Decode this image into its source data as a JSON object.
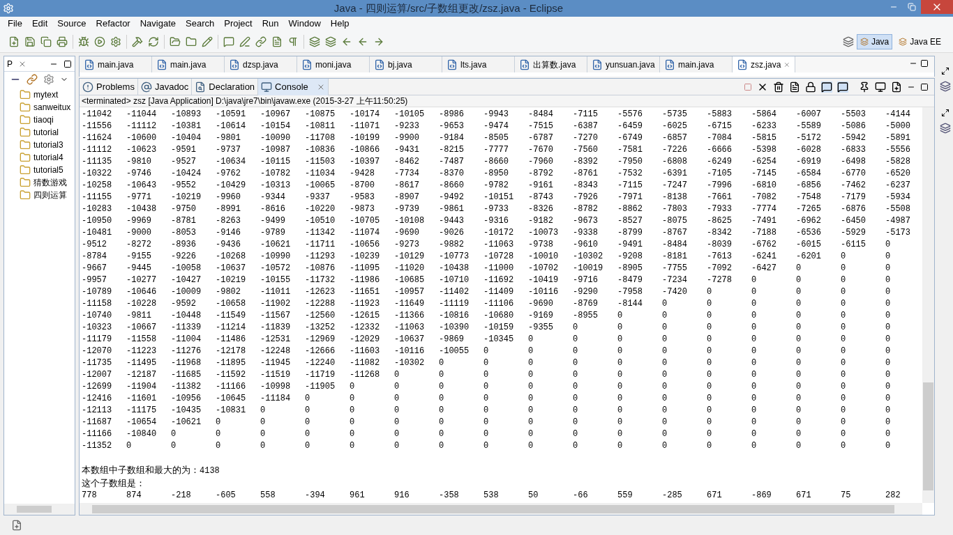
{
  "window": {
    "title": "Java - 四则运算/src/子数组更改/zsz.java - Eclipse"
  },
  "menu": [
    "File",
    "Edit",
    "Source",
    "Refactor",
    "Navigate",
    "Search",
    "Project",
    "Run",
    "Window",
    "Help"
  ],
  "perspectives": [
    {
      "label": "Java",
      "selected": true
    },
    {
      "label": "Java EE",
      "selected": false
    }
  ],
  "package_explorer": {
    "tab": "P",
    "projects": [
      "mytext",
      "sanweitux",
      "tiaoqi",
      "tutorial",
      "tutorial3",
      "tutorial4",
      "tutorial5",
      "猜数游戏",
      "四则运算"
    ]
  },
  "editor_tabs": [
    {
      "label": "main.java",
      "selected": false
    },
    {
      "label": "main.java",
      "selected": false
    },
    {
      "label": "dzsp.java",
      "selected": false
    },
    {
      "label": "moni.java",
      "selected": false
    },
    {
      "label": "bj.java",
      "selected": false
    },
    {
      "label": "lts.java",
      "selected": false
    },
    {
      "label": "出算数.java",
      "selected": false
    },
    {
      "label": "yunsuan.java",
      "selected": false
    },
    {
      "label": "main.java",
      "selected": false
    },
    {
      "label": "zsz.java",
      "selected": true
    }
  ],
  "view_tabs": [
    {
      "label": "Problems",
      "selected": false
    },
    {
      "label": "Javadoc",
      "selected": false
    },
    {
      "label": "Declaration",
      "selected": false
    },
    {
      "label": "Console",
      "selected": true
    }
  ],
  "console": {
    "header": "<terminated> zsz [Java Application] D:\\java\\jre7\\bin\\javaw.exe (2015-3-27 上午11:50:25)",
    "rows": [
      [
        "-11042",
        "-11044",
        "-10893",
        "-10591",
        "-10967",
        "-10875",
        "-10174",
        "-10105",
        "-8986",
        "-9943",
        "-8484",
        "-7115",
        "-5576",
        "-5735",
        "-5883",
        "-5864",
        "-6007",
        "-5503",
        "-4144"
      ],
      [
        "-11556",
        "-11112",
        "-10381",
        "-10614",
        "-10154",
        "-10811",
        "-11071",
        "-9233",
        "-9653",
        "-9474",
        "-7515",
        "-6387",
        "-6459",
        "-6025",
        "-6715",
        "-6233",
        "-5589",
        "-5086",
        "-5000"
      ],
      [
        "-11624",
        "-10600",
        "-10404",
        "-9801",
        "-10090",
        "-11708",
        "-10199",
        "-9900",
        "-9184",
        "-8505",
        "-6787",
        "-7270",
        "-6749",
        "-6857",
        "-7084",
        "-5815",
        "-5172",
        "-5942",
        "-5891"
      ],
      [
        "-11112",
        "-10623",
        "-9591",
        "-9737",
        "-10987",
        "-10836",
        "-10866",
        "-9431",
        "-8215",
        "-7777",
        "-7670",
        "-7560",
        "-7581",
        "-7226",
        "-6666",
        "-5398",
        "-6028",
        "-6833",
        "-5556"
      ],
      [
        "-11135",
        "-9810",
        "-9527",
        "-10634",
        "-10115",
        "-11503",
        "-10397",
        "-8462",
        "-7487",
        "-8660",
        "-7960",
        "-8392",
        "-7950",
        "-6808",
        "-6249",
        "-6254",
        "-6919",
        "-6498",
        "-5828"
      ],
      [
        "-10322",
        "-9746",
        "-10424",
        "-9762",
        "-10782",
        "-11034",
        "-9428",
        "-7734",
        "-8370",
        "-8950",
        "-8792",
        "-8761",
        "-7532",
        "-6391",
        "-7105",
        "-7145",
        "-6584",
        "-6770",
        "-6520"
      ],
      [
        "-10258",
        "-10643",
        "-9552",
        "-10429",
        "-10313",
        "-10065",
        "-8700",
        "-8617",
        "-8660",
        "-9782",
        "-9161",
        "-8343",
        "-7115",
        "-7247",
        "-7996",
        "-6810",
        "-6856",
        "-7462",
        "-6237"
      ],
      [
        "-11155",
        "-9771",
        "-10219",
        "-9960",
        "-9344",
        "-9337",
        "-9583",
        "-8907",
        "-9492",
        "-10151",
        "-8743",
        "-7926",
        "-7971",
        "-8138",
        "-7661",
        "-7082",
        "-7548",
        "-7179",
        "-5934"
      ],
      [
        "-10283",
        "-10438",
        "-9750",
        "-8991",
        "-8616",
        "-10220",
        "-9873",
        "-9739",
        "-9861",
        "-9733",
        "-8326",
        "-8782",
        "-8862",
        "-7803",
        "-7933",
        "-7774",
        "-7265",
        "-6876",
        "-5508"
      ],
      [
        "-10950",
        "-9969",
        "-8781",
        "-8263",
        "-9499",
        "-10510",
        "-10705",
        "-10108",
        "-9443",
        "-9316",
        "-9182",
        "-9673",
        "-8527",
        "-8075",
        "-8625",
        "-7491",
        "-6962",
        "-6450",
        "-4987"
      ],
      [
        "-10481",
        "-9000",
        "-8053",
        "-9146",
        "-9789",
        "-11342",
        "-11074",
        "-9690",
        "-9026",
        "-10172",
        "-10073",
        "-9338",
        "-8799",
        "-8767",
        "-8342",
        "-7188",
        "-6536",
        "-5929",
        "-5173"
      ],
      [
        "-9512",
        "-8272",
        "-8936",
        "-9436",
        "-10621",
        "-11711",
        "-10656",
        "-9273",
        "-9882",
        "-11063",
        "-9738",
        "-9610",
        "-9491",
        "-8484",
        "-8039",
        "-6762",
        "-6015",
        "-6115",
        "0"
      ],
      [
        "-8784",
        "-9155",
        "-9226",
        "-10268",
        "-10990",
        "-11293",
        "-10239",
        "-10129",
        "-10773",
        "-10728",
        "-10010",
        "-10302",
        "-9208",
        "-8181",
        "-7613",
        "-6241",
        "-6201",
        "0",
        "0"
      ],
      [
        "-9667",
        "-9445",
        "-10058",
        "-10637",
        "-10572",
        "-10876",
        "-11095",
        "-11020",
        "-10438",
        "-11000",
        "-10702",
        "-10019",
        "-8905",
        "-7755",
        "-7092",
        "-6427",
        "0",
        "0",
        "0"
      ],
      [
        "-9957",
        "-10277",
        "-10427",
        "-10219",
        "-10155",
        "-11732",
        "-11986",
        "-10685",
        "-10710",
        "-11692",
        "-10419",
        "-9716",
        "-8479",
        "-7234",
        "-7278",
        "0",
        "0",
        "0",
        "0"
      ],
      [
        "-10789",
        "-10646",
        "-10009",
        "-9802",
        "-11011",
        "-12623",
        "-11651",
        "-10957",
        "-11402",
        "-11409",
        "-10116",
        "-9290",
        "-7958",
        "-7420",
        "0",
        "0",
        "0",
        "0",
        "0"
      ],
      [
        "-11158",
        "-10228",
        "-9592",
        "-10658",
        "-11902",
        "-12288",
        "-11923",
        "-11649",
        "-11119",
        "-11106",
        "-9690",
        "-8769",
        "-8144",
        "0",
        "0",
        "0",
        "0",
        "0",
        "0"
      ],
      [
        "-10740",
        "-9811",
        "-10448",
        "-11549",
        "-11567",
        "-12560",
        "-12615",
        "-11366",
        "-10816",
        "-10680",
        "-9169",
        "-8955",
        "0",
        "0",
        "0",
        "0",
        "0",
        "0",
        "0"
      ],
      [
        "-10323",
        "-10667",
        "-11339",
        "-11214",
        "-11839",
        "-13252",
        "-12332",
        "-11063",
        "-10390",
        "-10159",
        "-9355",
        "0",
        "0",
        "0",
        "0",
        "0",
        "0",
        "0",
        "0"
      ],
      [
        "-11179",
        "-11558",
        "-11004",
        "-11486",
        "-12531",
        "-12969",
        "-12029",
        "-10637",
        "-9869",
        "-10345",
        "0",
        "0",
        "0",
        "0",
        "0",
        "0",
        "0",
        "0",
        "0"
      ],
      [
        "-12070",
        "-11223",
        "-11276",
        "-12178",
        "-12248",
        "-12666",
        "-11603",
        "-10116",
        "-10055",
        "0",
        "0",
        "0",
        "0",
        "0",
        "0",
        "0",
        "0",
        "0",
        "0"
      ],
      [
        "-11735",
        "-11495",
        "-11968",
        "-11895",
        "-11945",
        "-12240",
        "-11082",
        "-10302",
        "0",
        "0",
        "0",
        "0",
        "0",
        "0",
        "0",
        "0",
        "0",
        "0",
        "0"
      ],
      [
        "-12007",
        "-12187",
        "-11685",
        "-11592",
        "-11519",
        "-11719",
        "-11268",
        "0",
        "0",
        "0",
        "0",
        "0",
        "0",
        "0",
        "0",
        "0",
        "0",
        "0",
        "0"
      ],
      [
        "-12699",
        "-11904",
        "-11382",
        "-11166",
        "-10998",
        "-11905",
        "0",
        "0",
        "0",
        "0",
        "0",
        "0",
        "0",
        "0",
        "0",
        "0",
        "0",
        "0",
        "0"
      ],
      [
        "-12416",
        "-11601",
        "-10956",
        "-10645",
        "-11184",
        "0",
        "0",
        "0",
        "0",
        "0",
        "0",
        "0",
        "0",
        "0",
        "0",
        "0",
        "0",
        "0",
        "0"
      ],
      [
        "-12113",
        "-11175",
        "-10435",
        "-10831",
        "0",
        "0",
        "0",
        "0",
        "0",
        "0",
        "0",
        "0",
        "0",
        "0",
        "0",
        "0",
        "0",
        "0",
        "0"
      ],
      [
        "-11687",
        "-10654",
        "-10621",
        "0",
        "0",
        "0",
        "0",
        "0",
        "0",
        "0",
        "0",
        "0",
        "0",
        "0",
        "0",
        "0",
        "0",
        "0",
        "0"
      ],
      [
        "-11166",
        "-10840",
        "0",
        "0",
        "0",
        "0",
        "0",
        "0",
        "0",
        "0",
        "0",
        "0",
        "0",
        "0",
        "0",
        "0",
        "0",
        "0",
        "0"
      ],
      [
        "-11352",
        "0",
        "0",
        "0",
        "0",
        "0",
        "0",
        "0",
        "0",
        "0",
        "0",
        "0",
        "0",
        "0",
        "0",
        "0",
        "0",
        "0",
        "0"
      ]
    ],
    "result_label": "本数组中子数组和最大的为：",
    "result_value": "4138",
    "subarray_label": "这个子数组是：",
    "subarray": [
      "778",
      "874",
      "-218",
      "-605",
      "558",
      "-394",
      "961",
      "916",
      "-358",
      "538",
      "50",
      "-66",
      "559",
      "-285",
      "671",
      "-869",
      "671",
      "75",
      "282"
    ]
  }
}
